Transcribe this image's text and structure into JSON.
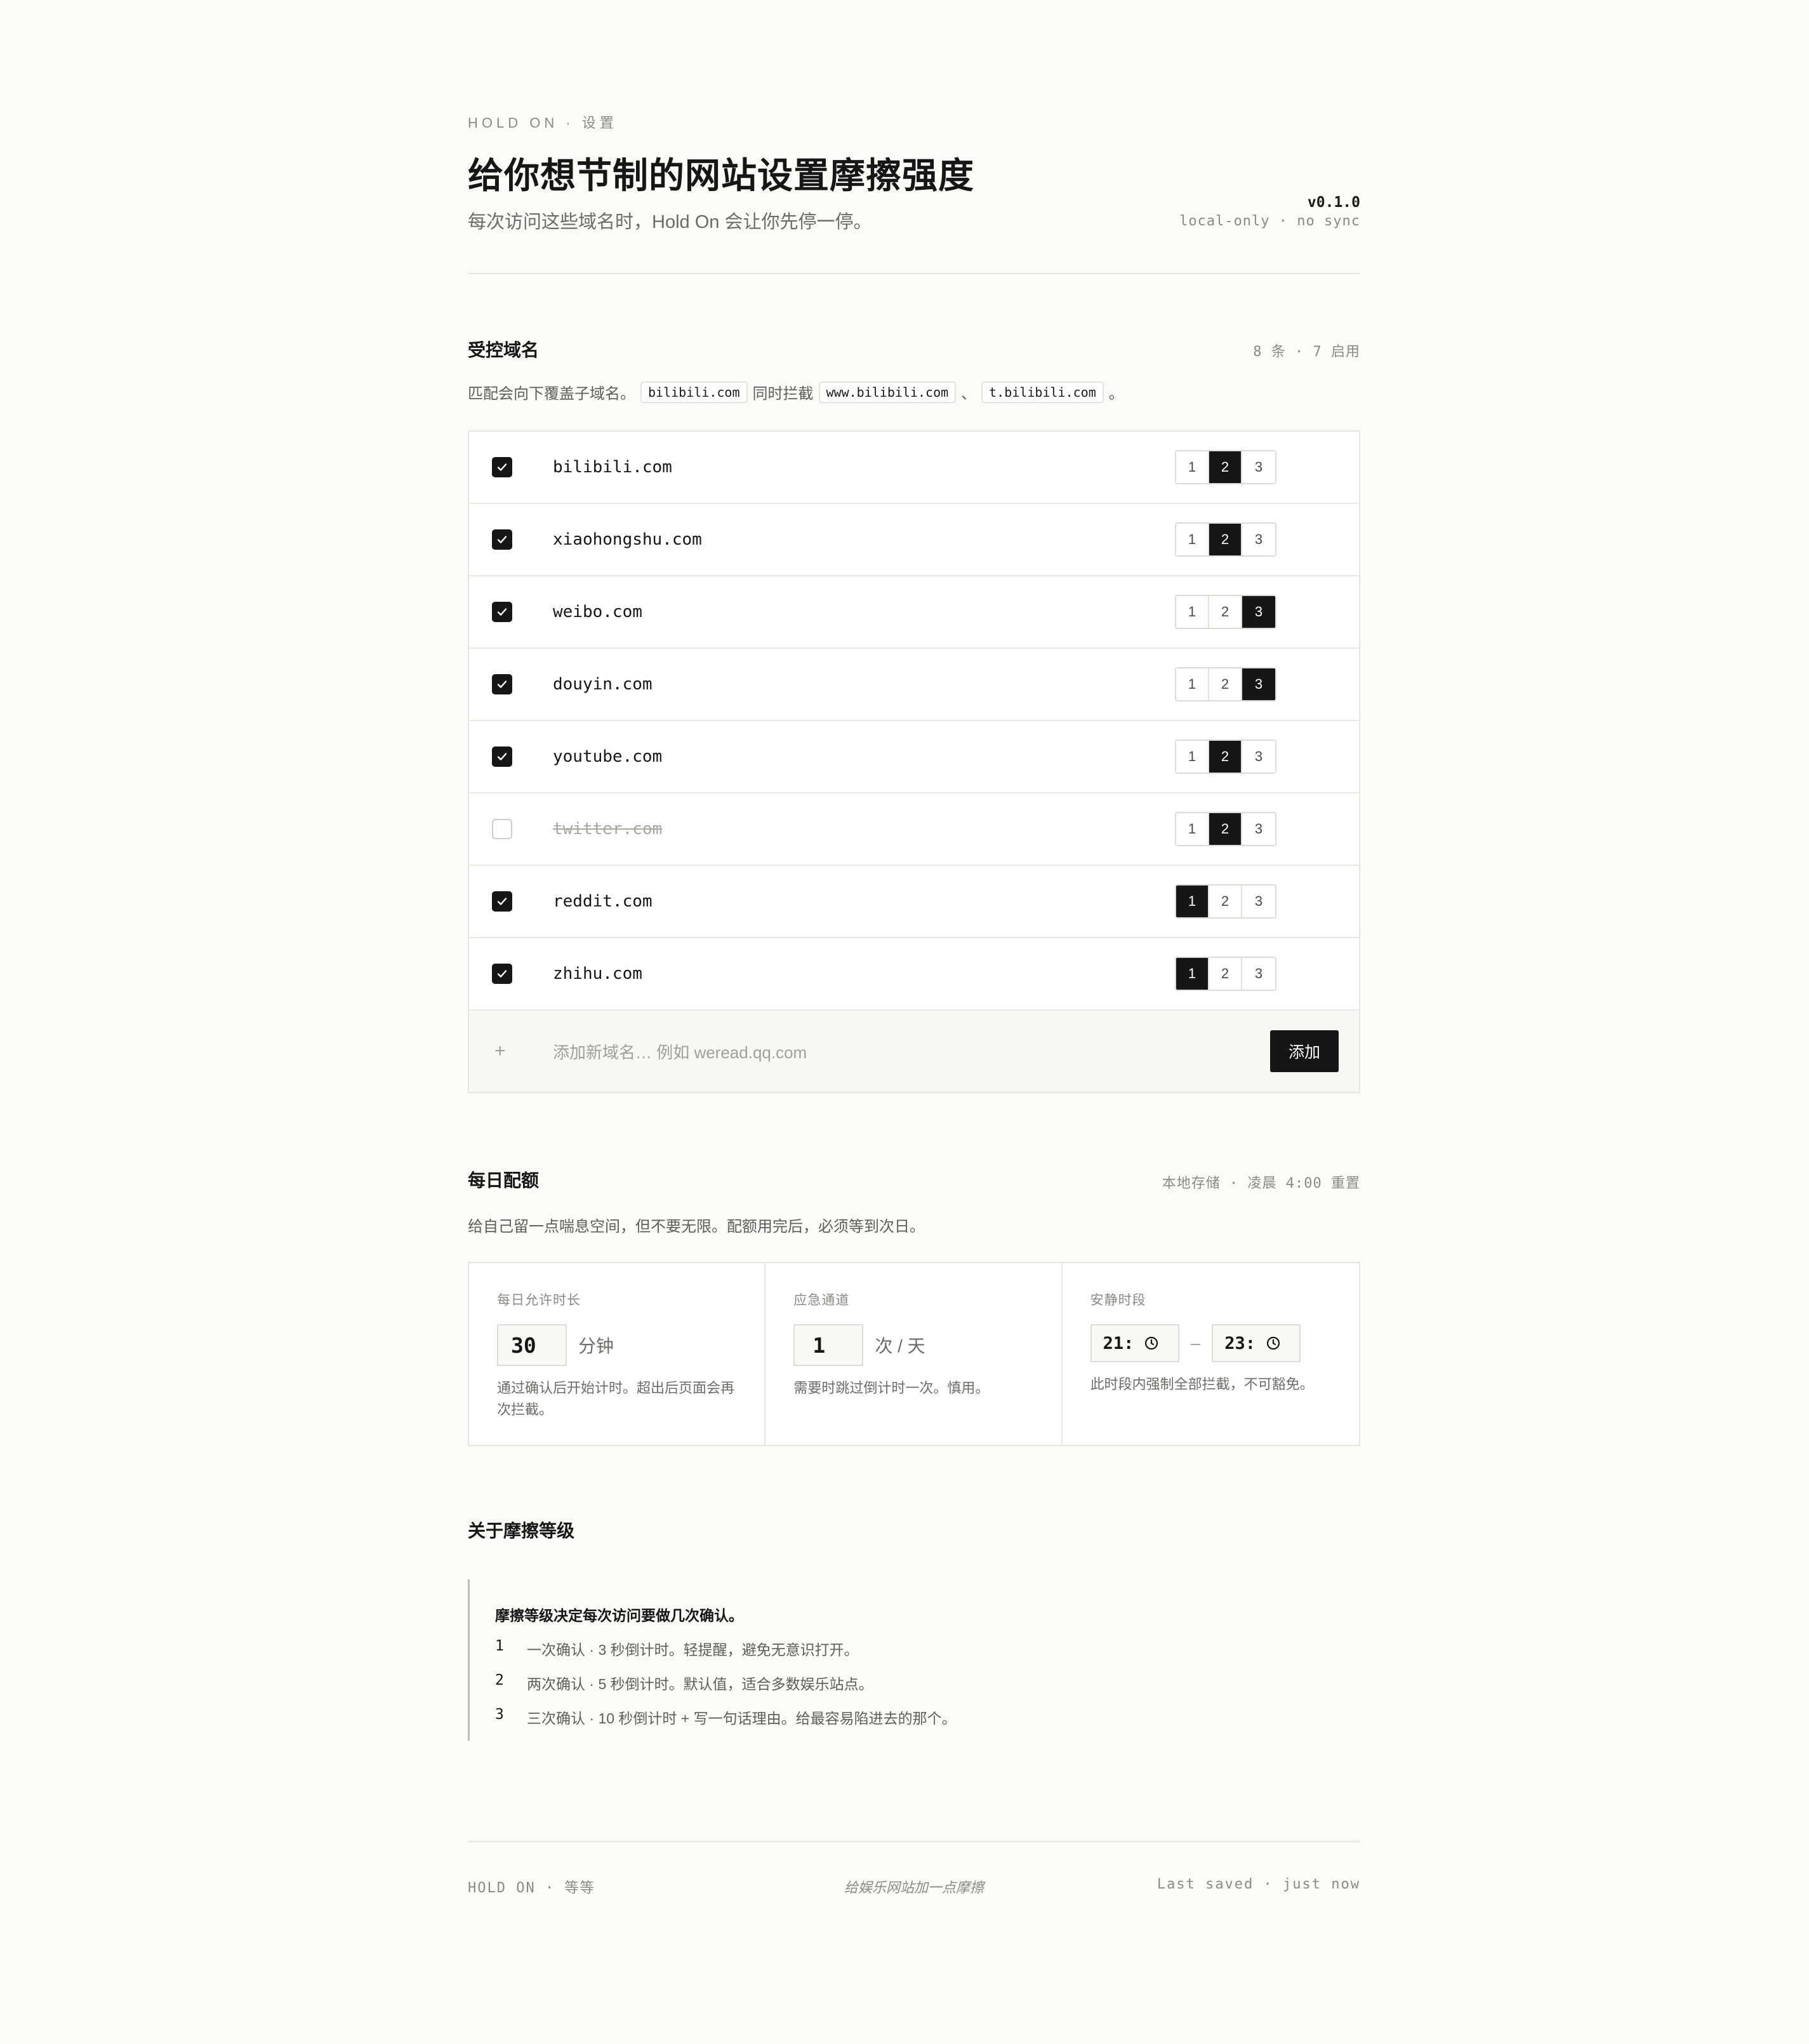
{
  "header": {
    "eyebrow": "HOLD ON · 设置",
    "title": "给你想节制的网站设置摩擦强度",
    "subtitle": "每次访问这些域名时，Hold On 会让你先停一停。",
    "version": "v0.1.0",
    "sync": "local-only · no sync"
  },
  "domains_section": {
    "title": "受控域名",
    "meta": "8 条 · 7 启用",
    "desc_prefix": "匹配会向下覆盖子域名。",
    "code_1": "bilibili.com",
    "desc_mid": "同时拦截",
    "code_2": "www.bilibili.com",
    "sep": "、",
    "code_3": "t.bilibili.com",
    "desc_end": "。",
    "items": [
      {
        "domain": "bilibili.com",
        "enabled": true,
        "level": 2
      },
      {
        "domain": "xiaohongshu.com",
        "enabled": true,
        "level": 2
      },
      {
        "domain": "weibo.com",
        "enabled": true,
        "level": 3
      },
      {
        "domain": "douyin.com",
        "enabled": true,
        "level": 3
      },
      {
        "domain": "youtube.com",
        "enabled": true,
        "level": 2
      },
      {
        "domain": "twitter.com",
        "enabled": false,
        "level": 2
      },
      {
        "domain": "reddit.com",
        "enabled": true,
        "level": 1
      },
      {
        "domain": "zhihu.com",
        "enabled": true,
        "level": 1
      }
    ],
    "level_labels": [
      "1",
      "2",
      "3"
    ],
    "add_placeholder": "添加新域名…  例如 weread.qq.com",
    "add_icon": "+",
    "add_button": "添加"
  },
  "quota_section": {
    "title": "每日配额",
    "meta": "本地存储 · 凌晨 4:00 重置",
    "desc": "给自己留一点喘息空间，但不要无限。配额用完后，必须等到次日。",
    "daily": {
      "label": "每日允许时长",
      "value": "30",
      "unit": "分钟",
      "help": "通过确认后开始计时。超出后页面会再次拦截。"
    },
    "emergency": {
      "label": "应急通道",
      "value": "1",
      "unit": "次 / 天",
      "help": "需要时跳过倒计时一次。慎用。"
    },
    "quiet": {
      "label": "安静时段",
      "start": "21:",
      "end": "23:",
      "dash": "–",
      "help": "此时段内强制全部拦截，不可豁免。"
    }
  },
  "about_section": {
    "title": "关于摩擦等级",
    "head": "摩擦等级决定每次访问要做几次确认。",
    "items": [
      {
        "n": "1",
        "text": "一次确认 · 3 秒倒计时。轻提醒，避免无意识打开。"
      },
      {
        "n": "2",
        "text": "两次确认 · 5 秒倒计时。默认值，适合多数娱乐站点。"
      },
      {
        "n": "3",
        "text": "三次确认 · 10 秒倒计时 + 写一句话理由。给最容易陷进去的那个。"
      }
    ]
  },
  "footer": {
    "left": "HOLD ON · 等等",
    "center": "给娱乐网站加一点摩擦",
    "right": "Last saved · just now"
  },
  "colors": {
    "background": "#fafaf7",
    "ink": "#161616",
    "muted": "#8a8a86",
    "border": "#e6e6e1"
  }
}
